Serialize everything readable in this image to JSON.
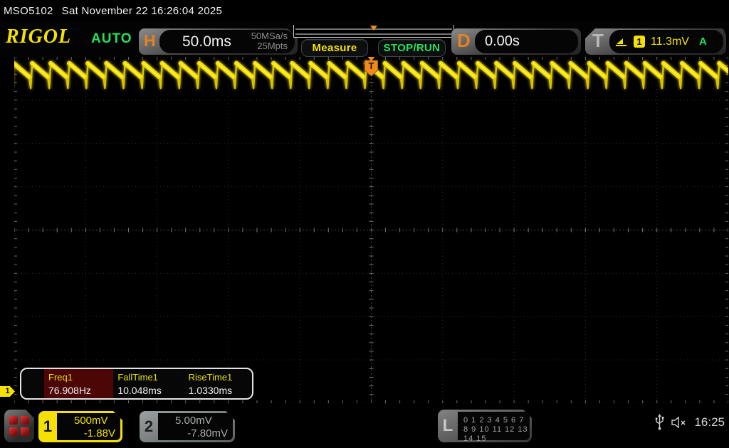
{
  "topbar": {
    "model": "MSO5102",
    "datetime": "Sat November 22 16:26:04 2025"
  },
  "header": {
    "logo": "RIGOL",
    "mode": "AUTO",
    "h_label": "H",
    "timebase": "50.0ms",
    "sample_rate": "50MSa/s",
    "memory_depth": "25Mpts",
    "measure_label": "Measure",
    "stoprun_label": "STOP/RUN",
    "d_label": "D",
    "delay": "0.00s",
    "t_label": "T",
    "trigger_source": "1",
    "trigger_level": "11.3mV",
    "trigger_sweep": "A"
  },
  "measurements": {
    "items": [
      {
        "label": "Freq1",
        "value": "76.908Hz",
        "highlighted": true
      },
      {
        "label": "FallTime1",
        "value": "10.048ms",
        "highlighted": false
      },
      {
        "label": "RiseTime1",
        "value": "1.0330ms",
        "highlighted": false
      }
    ]
  },
  "channels": [
    {
      "id": "1",
      "scale": "500mV",
      "offset": "-1.88V",
      "active": true
    },
    {
      "id": "2",
      "scale": "5.00mV",
      "offset": "-7.80mV",
      "active": false
    }
  ],
  "logic": {
    "label": "L",
    "row1": "0 1 2 3  4 5 6 7",
    "row2": "8 9 10 11 12 13 14 15"
  },
  "statusbar": {
    "time": "16:25"
  },
  "chart_data": {
    "type": "line",
    "signal_shape": "sawtooth",
    "channel": "CH1",
    "frequency_hz": 76.908,
    "period_ms": 13.003,
    "rise_time_ms": 1.033,
    "fall_time_ms": 10.048,
    "timebase_ms_per_div": 50,
    "h_divisions": 10,
    "v_divisions": 8,
    "vertical_scale": "500mV/div",
    "vertical_offset": "-1.88V",
    "trigger_level": "11.3mV",
    "grid": "dotted"
  },
  "colors": {
    "channel1": "#f5e003",
    "channel2": "#9aa0a0",
    "trigger_orange": "#e8821e",
    "run_green": "#21e359",
    "highlight_red": "#4c0606"
  }
}
